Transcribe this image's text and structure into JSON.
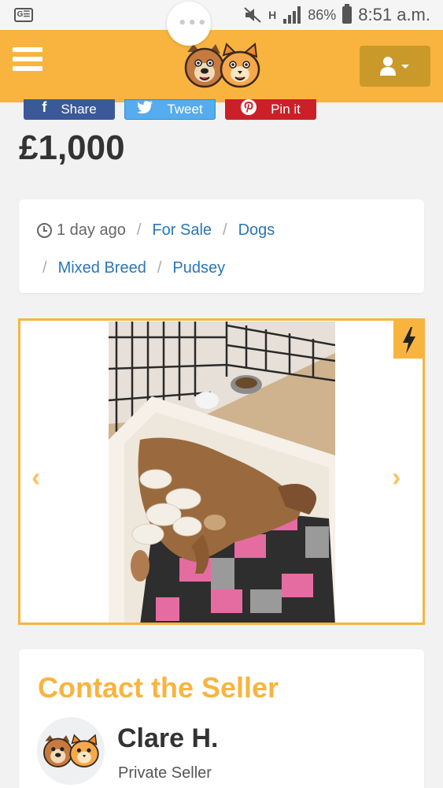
{
  "status_bar": {
    "carrier_badge": "G☰",
    "network_h": "H",
    "battery_percent": "86%",
    "time": "8:51 a.m.",
    "icons": [
      "gallery-badge-icon",
      "mute-icon",
      "network-h-icon",
      "signal-icon",
      "battery-icon"
    ],
    "overlay_dots": "•••"
  },
  "header": {
    "menu_icon": "hamburger-menu-icon",
    "logo_icon": "dog-cat-logo-icon",
    "user_icon": "user-icon",
    "dropdown_icon": "caret-down-icon",
    "background_color": "#f8b43f"
  },
  "share": {
    "facebook": {
      "icon": "f",
      "label": "Share"
    },
    "twitter": {
      "icon": "twitter-bird-icon",
      "label": "Tweet"
    },
    "pinterest": {
      "icon": "pinterest-icon",
      "label": "Pin it"
    }
  },
  "listing": {
    "price": "£1,000",
    "posted": "1 day ago",
    "breadcrumbs": [
      "For Sale",
      "Dogs",
      "Mixed Breed",
      "Pudsey"
    ],
    "separator": "/"
  },
  "gallery": {
    "prev_arrow": "‹",
    "next_arrow": "›",
    "badge_icon": "lightning-bolt-icon",
    "accent_color": "#f8b43f"
  },
  "contact": {
    "title": "Contact the Seller",
    "seller_name": "Clare H.",
    "seller_type": "Private Seller",
    "title_color": "#f8b43f"
  }
}
